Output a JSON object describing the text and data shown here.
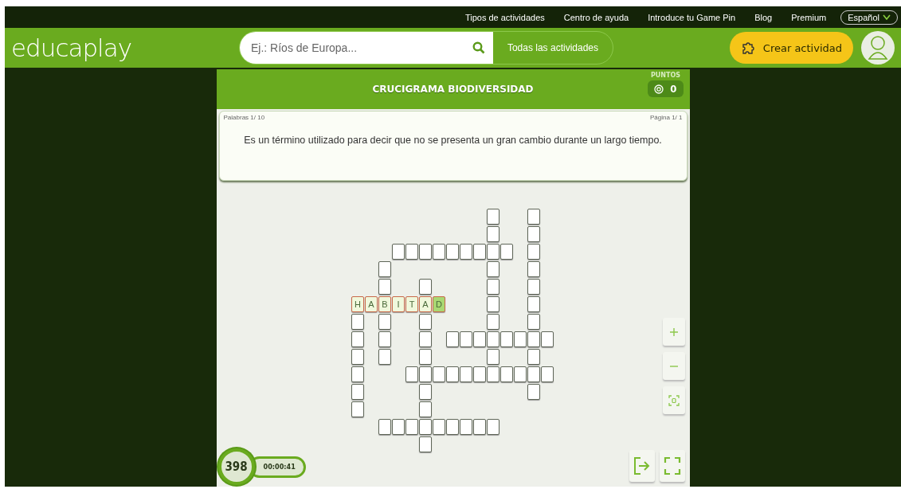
{
  "top_links": [
    {
      "label": "Tipos de actividades"
    },
    {
      "label": "Centro de ayuda"
    },
    {
      "label": "Introduce tu Game Pin"
    },
    {
      "label": "Blog"
    },
    {
      "label": "Premium"
    }
  ],
  "language": {
    "label": "Español",
    "expanded": false
  },
  "logo": {
    "text": "educaplay"
  },
  "search": {
    "placeholder": "Ej.: Ríos de Europa...",
    "scope": "Todas las actividades"
  },
  "create_button": {
    "label": "Crear actividad"
  },
  "activity": {
    "title": "CRUCIGRAMA BIODIVERSIDAD",
    "points_label": "PUNTOS",
    "points": "0"
  },
  "question": {
    "words": "Palabras 1/ 10",
    "page": "Página 1/ 1",
    "clue": "Es un término utilizado para decir que no se presenta un gran cambio durante un largo tiempo."
  },
  "grid": [
    [
      {
        "kind": "gap"
      },
      {
        "kind": "gap"
      },
      {
        "kind": "gap"
      },
      {
        "kind": "gap"
      },
      {
        "kind": "gap"
      },
      {
        "kind": "gap"
      },
      {
        "kind": "gap"
      },
      {
        "kind": "gap"
      },
      {
        "kind": "gap"
      },
      {
        "kind": "gap"
      },
      {
        "kind": "empty"
      },
      {
        "kind": "gap"
      },
      {
        "kind": "gap"
      },
      {
        "kind": "empty"
      },
      {
        "kind": "gap"
      }
    ],
    [
      {
        "kind": "gap"
      },
      {
        "kind": "gap"
      },
      {
        "kind": "gap"
      },
      {
        "kind": "gap"
      },
      {
        "kind": "gap"
      },
      {
        "kind": "gap"
      },
      {
        "kind": "gap"
      },
      {
        "kind": "gap"
      },
      {
        "kind": "gap"
      },
      {
        "kind": "gap"
      },
      {
        "kind": "empty"
      },
      {
        "kind": "gap"
      },
      {
        "kind": "gap"
      },
      {
        "kind": "empty"
      },
      {
        "kind": "gap"
      }
    ],
    [
      {
        "kind": "gap"
      },
      {
        "kind": "gap"
      },
      {
        "kind": "gap"
      },
      {
        "kind": "empty"
      },
      {
        "kind": "empty"
      },
      {
        "kind": "empty"
      },
      {
        "kind": "empty"
      },
      {
        "kind": "empty"
      },
      {
        "kind": "empty"
      },
      {
        "kind": "empty"
      },
      {
        "kind": "empty"
      },
      {
        "kind": "empty"
      },
      {
        "kind": "gap"
      },
      {
        "kind": "empty"
      },
      {
        "kind": "gap"
      }
    ],
    [
      {
        "kind": "gap"
      },
      {
        "kind": "gap"
      },
      {
        "kind": "empty"
      },
      {
        "kind": "gap"
      },
      {
        "kind": "gap"
      },
      {
        "kind": "gap"
      },
      {
        "kind": "gap"
      },
      {
        "kind": "gap"
      },
      {
        "kind": "gap"
      },
      {
        "kind": "gap"
      },
      {
        "kind": "empty"
      },
      {
        "kind": "gap"
      },
      {
        "kind": "gap"
      },
      {
        "kind": "empty"
      },
      {
        "kind": "gap"
      }
    ],
    [
      {
        "kind": "gap"
      },
      {
        "kind": "gap"
      },
      {
        "kind": "empty"
      },
      {
        "kind": "gap"
      },
      {
        "kind": "gap"
      },
      {
        "kind": "empty"
      },
      {
        "kind": "gap"
      },
      {
        "kind": "gap"
      },
      {
        "kind": "gap"
      },
      {
        "kind": "gap"
      },
      {
        "kind": "empty"
      },
      {
        "kind": "gap"
      },
      {
        "kind": "gap"
      },
      {
        "kind": "empty"
      },
      {
        "kind": "gap"
      }
    ],
    [
      {
        "kind": "active",
        "letter": "H"
      },
      {
        "kind": "active",
        "letter": "A"
      },
      {
        "kind": "active",
        "letter": "B"
      },
      {
        "kind": "active",
        "letter": "I"
      },
      {
        "kind": "active",
        "letter": "T"
      },
      {
        "kind": "active",
        "letter": "A"
      },
      {
        "kind": "cursor",
        "letter": "D"
      },
      {
        "kind": "gap"
      },
      {
        "kind": "gap"
      },
      {
        "kind": "gap"
      },
      {
        "kind": "empty"
      },
      {
        "kind": "gap"
      },
      {
        "kind": "gap"
      },
      {
        "kind": "empty"
      },
      {
        "kind": "gap"
      }
    ],
    [
      {
        "kind": "empty"
      },
      {
        "kind": "gap"
      },
      {
        "kind": "empty"
      },
      {
        "kind": "gap"
      },
      {
        "kind": "gap"
      },
      {
        "kind": "empty"
      },
      {
        "kind": "gap"
      },
      {
        "kind": "gap"
      },
      {
        "kind": "gap"
      },
      {
        "kind": "gap"
      },
      {
        "kind": "empty"
      },
      {
        "kind": "gap"
      },
      {
        "kind": "gap"
      },
      {
        "kind": "empty"
      },
      {
        "kind": "gap"
      }
    ],
    [
      {
        "kind": "empty"
      },
      {
        "kind": "gap"
      },
      {
        "kind": "empty"
      },
      {
        "kind": "gap"
      },
      {
        "kind": "gap"
      },
      {
        "kind": "empty"
      },
      {
        "kind": "gap"
      },
      {
        "kind": "empty"
      },
      {
        "kind": "empty"
      },
      {
        "kind": "empty"
      },
      {
        "kind": "empty"
      },
      {
        "kind": "empty"
      },
      {
        "kind": "empty"
      },
      {
        "kind": "empty"
      },
      {
        "kind": "empty"
      }
    ],
    [
      {
        "kind": "empty"
      },
      {
        "kind": "gap"
      },
      {
        "kind": "empty"
      },
      {
        "kind": "gap"
      },
      {
        "kind": "gap"
      },
      {
        "kind": "empty"
      },
      {
        "kind": "gap"
      },
      {
        "kind": "gap"
      },
      {
        "kind": "gap"
      },
      {
        "kind": "gap"
      },
      {
        "kind": "empty"
      },
      {
        "kind": "gap"
      },
      {
        "kind": "gap"
      },
      {
        "kind": "empty"
      },
      {
        "kind": "gap"
      }
    ],
    [
      {
        "kind": "empty"
      },
      {
        "kind": "gap"
      },
      {
        "kind": "gap"
      },
      {
        "kind": "gap"
      },
      {
        "kind": "empty"
      },
      {
        "kind": "empty"
      },
      {
        "kind": "empty"
      },
      {
        "kind": "empty"
      },
      {
        "kind": "empty"
      },
      {
        "kind": "empty"
      },
      {
        "kind": "empty"
      },
      {
        "kind": "empty"
      },
      {
        "kind": "empty"
      },
      {
        "kind": "empty"
      },
      {
        "kind": "empty"
      }
    ],
    [
      {
        "kind": "empty"
      },
      {
        "kind": "gap"
      },
      {
        "kind": "gap"
      },
      {
        "kind": "gap"
      },
      {
        "kind": "gap"
      },
      {
        "kind": "empty"
      },
      {
        "kind": "gap"
      },
      {
        "kind": "gap"
      },
      {
        "kind": "gap"
      },
      {
        "kind": "gap"
      },
      {
        "kind": "gap"
      },
      {
        "kind": "gap"
      },
      {
        "kind": "gap"
      },
      {
        "kind": "empty"
      },
      {
        "kind": "gap"
      }
    ],
    [
      {
        "kind": "empty"
      },
      {
        "kind": "gap"
      },
      {
        "kind": "gap"
      },
      {
        "kind": "gap"
      },
      {
        "kind": "gap"
      },
      {
        "kind": "empty"
      },
      {
        "kind": "gap"
      },
      {
        "kind": "gap"
      },
      {
        "kind": "gap"
      },
      {
        "kind": "gap"
      },
      {
        "kind": "gap"
      },
      {
        "kind": "gap"
      },
      {
        "kind": "gap"
      },
      {
        "kind": "gap"
      },
      {
        "kind": "gap"
      }
    ],
    [
      {
        "kind": "gap"
      },
      {
        "kind": "gap"
      },
      {
        "kind": "empty"
      },
      {
        "kind": "empty"
      },
      {
        "kind": "empty"
      },
      {
        "kind": "empty"
      },
      {
        "kind": "empty"
      },
      {
        "kind": "empty"
      },
      {
        "kind": "empty"
      },
      {
        "kind": "empty"
      },
      {
        "kind": "empty"
      },
      {
        "kind": "gap"
      },
      {
        "kind": "gap"
      },
      {
        "kind": "gap"
      },
      {
        "kind": "gap"
      }
    ],
    [
      {
        "kind": "gap"
      },
      {
        "kind": "gap"
      },
      {
        "kind": "gap"
      },
      {
        "kind": "gap"
      },
      {
        "kind": "gap"
      },
      {
        "kind": "empty"
      },
      {
        "kind": "gap"
      },
      {
        "kind": "gap"
      },
      {
        "kind": "gap"
      },
      {
        "kind": "gap"
      },
      {
        "kind": "gap"
      },
      {
        "kind": "gap"
      },
      {
        "kind": "gap"
      },
      {
        "kind": "gap"
      },
      {
        "kind": "gap"
      }
    ]
  ],
  "timer": {
    "score": "398",
    "time": "00:00:41"
  }
}
